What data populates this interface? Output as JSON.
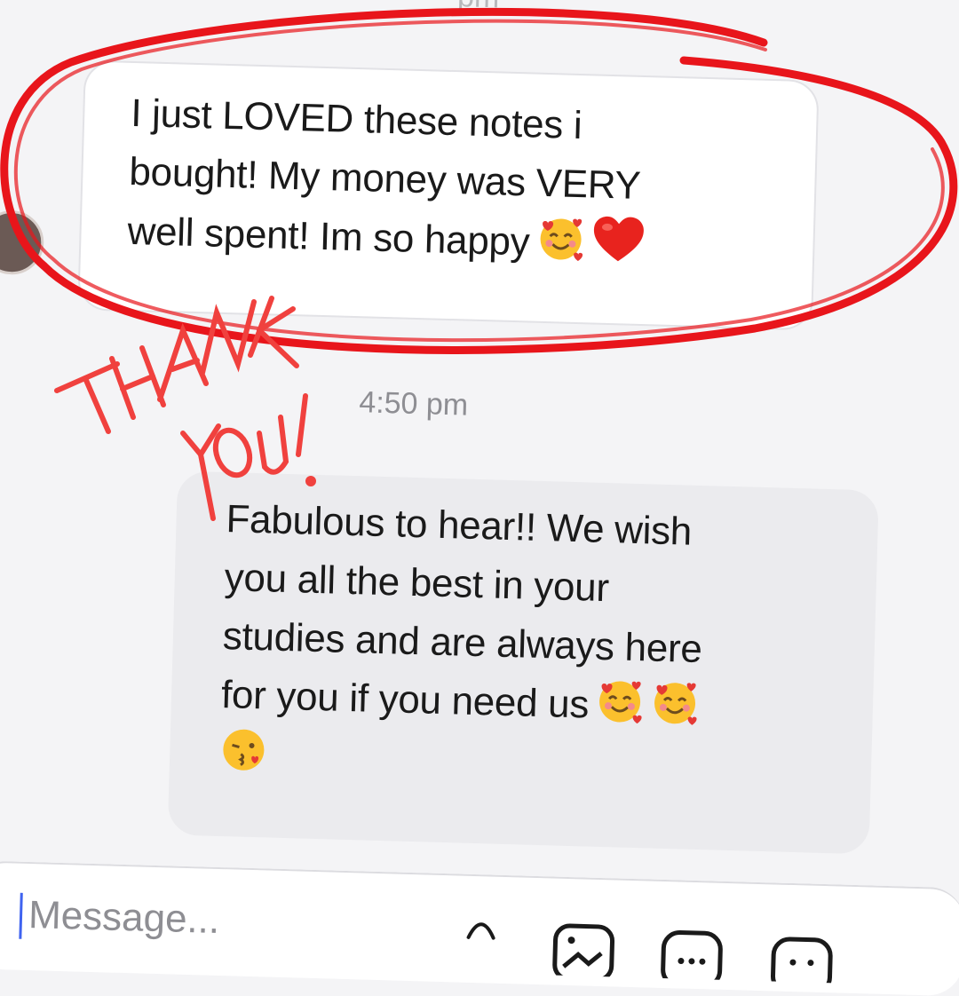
{
  "conversation": {
    "top_time_partial": "pm",
    "incoming_message": {
      "text": "I just LOVED these notes i\nbought! My money was VERY\nwell spent! Im so happy",
      "emojis": [
        "smiling-face-with-hearts",
        "red-heart"
      ]
    },
    "timestamp": "4:50 pm",
    "outgoing_message": {
      "text": "Fabulous to hear!! We wish\nyou all the best in your\nstudies and are always here\nfor you if you need us",
      "emojis": [
        "smiling-face-with-hearts",
        "smiling-face-with-hearts",
        "face-blowing-a-kiss"
      ]
    }
  },
  "annotation": {
    "handwriting": "THANK YOU!",
    "circle_color": "#e8151b",
    "handwriting_color": "#f0413e"
  },
  "composer": {
    "placeholder": "Message..."
  },
  "colors": {
    "accent": "#3f63f0",
    "incoming_bubble": "#ffffff",
    "outgoing_bubble": "#ebebee",
    "timestamp": "#8e8e93"
  }
}
